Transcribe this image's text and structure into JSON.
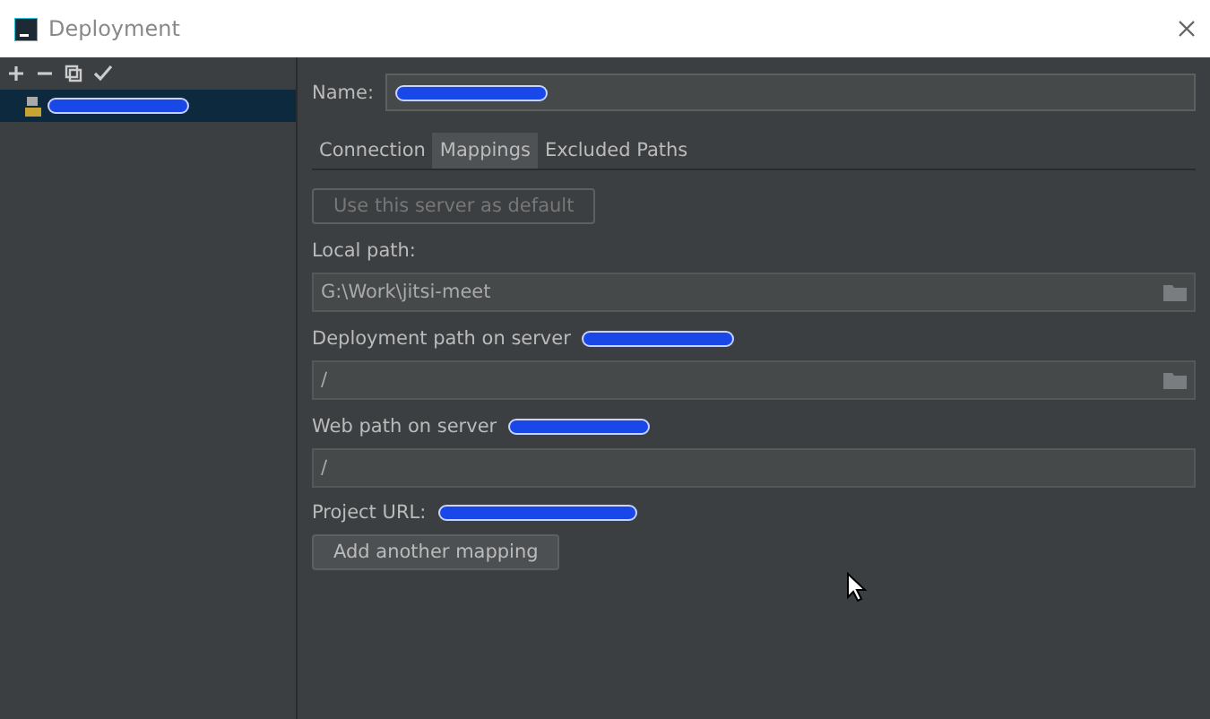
{
  "window": {
    "title": "Deployment"
  },
  "sidebar": {
    "items": [
      {
        "selected": true
      }
    ]
  },
  "name_field": {
    "label": "Name:"
  },
  "tabs": [
    {
      "label": "Connection",
      "selected": false
    },
    {
      "label": "Mappings",
      "selected": true
    },
    {
      "label": "Excluded Paths",
      "selected": false
    }
  ],
  "default_button": {
    "label": "Use this server as default",
    "disabled": true
  },
  "fields": [
    {
      "label": "Local path:",
      "value": "G:\\Work\\jitsi-meet",
      "browse": true
    },
    {
      "label": "Deployment path on server",
      "value": "/",
      "browse": true
    },
    {
      "label": "Web path on server",
      "value": "/",
      "browse": false
    }
  ],
  "project_url": {
    "label": "Project URL:"
  },
  "add_button": {
    "label": "Add another mapping",
    "disabled": false
  }
}
